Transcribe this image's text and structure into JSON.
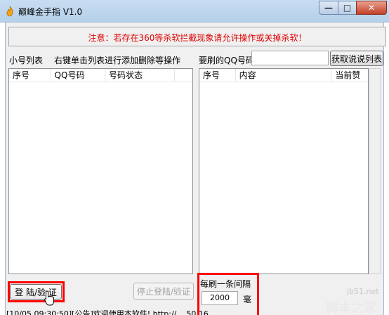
{
  "window": {
    "title": "巅峰金手指 V1.0",
    "icon": "app-flame-icon",
    "controls": {
      "minimize": "—",
      "maximize": "□",
      "close": "✕"
    }
  },
  "notice": {
    "text": "注意：若存在360等杀软拦截现象请允许操作或关掉杀软！",
    "color": "#e00000"
  },
  "left_panel": {
    "label": "小号列表",
    "hint": "右键单击列表进行添加删除等操作",
    "columns": [
      "序号",
      "QQ号码",
      "号码状态"
    ],
    "rows": []
  },
  "right_panel": {
    "qq_label": "要刷的QQ号码",
    "qq_input_value": "",
    "fetch_button": "获取说说列表",
    "columns": [
      "序号",
      "内容",
      "当前赞"
    ],
    "rows": []
  },
  "controls": {
    "login_button": "登 陆/验 证",
    "stop_button": "停止登陆/验证",
    "interval_label": "每刷一条间隔",
    "interval_value": "2000",
    "interval_suffix": "毫"
  },
  "status": {
    "text": "[10/05 09:30:50][公告]欢迎使用本软件! http://....50.16"
  },
  "watermark": {
    "brand": "jb51.net",
    "site": "脚本之家"
  },
  "colors": {
    "alert": "#e00000",
    "highlight": "#ff0000",
    "titlebar": "#c7ddf1"
  }
}
